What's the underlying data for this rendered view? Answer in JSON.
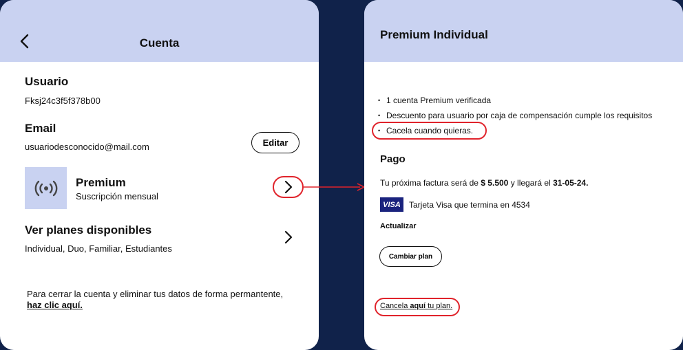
{
  "colors": {
    "background": "#10224a",
    "header": "#c9d2f1",
    "highlight": "#e0232b"
  },
  "left": {
    "header_title": "Cuenta",
    "back_icon": "chevron-left-icon",
    "usuario_label": "Usuario",
    "usuario_value": "Fksj24c3f5f378b00",
    "email_label": "Email",
    "email_value": "usuariodesconocido@mail.com",
    "edit_button": "Editar",
    "premium_icon": "broadcast-icon",
    "premium_title": "Premium",
    "premium_subtitle": "Suscripción mensual",
    "plans_title": "Ver planes disponibles",
    "plans_subtitle": "Individual, Duo, Familiar, Estudiantes",
    "footer_text": "Para cerrar la cuenta y eliminar tus datos de forma permantente,",
    "footer_link": "haz clic aquí."
  },
  "right": {
    "header_title": "Premium Individual",
    "bullets": [
      "1 cuenta Premium verificada",
      "Descuento para usuario por caja de compensación cumple los requisitos",
      "Cacela cuando quieras."
    ],
    "pago_title": "Pago",
    "factura_prefix": "Tu próxima factura será de",
    "factura_amount": "$ 5.500",
    "factura_mid": "y llegará el",
    "factura_date": "31-05-24.",
    "visa_logo": "VISA",
    "card_text": "Tarjeta Visa que termina en 4534",
    "actualizar": "Actualizar",
    "change_plan_button": "Cambiar plan",
    "cancel_prefix": "Cancela",
    "cancel_bold": "aquí",
    "cancel_suffix": "tu plan."
  }
}
